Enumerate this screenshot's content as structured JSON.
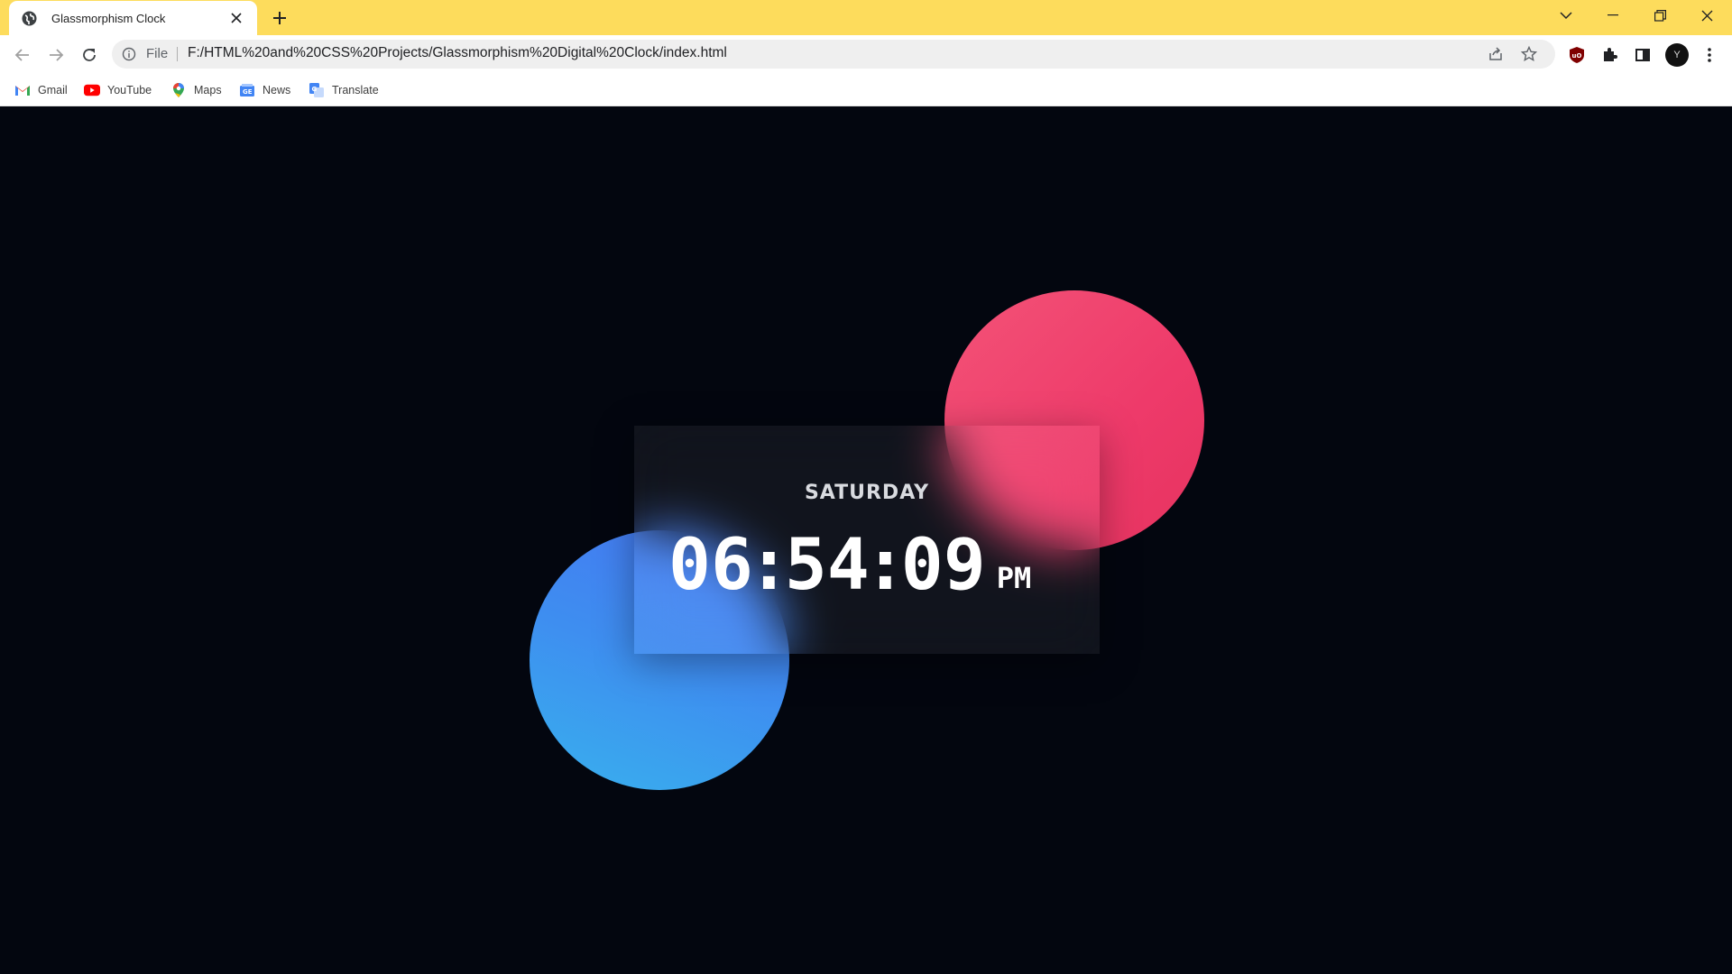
{
  "browser": {
    "tab": {
      "title": "Glassmorphism Clock",
      "favicon": "globe-icon"
    },
    "address": {
      "scheme_label": "File",
      "url": "F:/HTML%20and%20CSS%20Projects/Glassmorphism%20Digital%20Clock/index.html"
    },
    "bookmarks": [
      {
        "label": "Gmail",
        "icon": "gmail-icon"
      },
      {
        "label": "YouTube",
        "icon": "youtube-icon"
      },
      {
        "label": "Maps",
        "icon": "maps-icon"
      },
      {
        "label": "News",
        "icon": "news-icon"
      },
      {
        "label": "Translate",
        "icon": "translate-icon"
      }
    ],
    "profile_initial": "Y",
    "titlebar_color": "#fddc5c"
  },
  "clock": {
    "day": "SATURDAY",
    "hours": "06",
    "minutes": "54",
    "seconds": "09",
    "separator": ":",
    "ampm": "PM"
  },
  "colors": {
    "background": "#03060f",
    "red_circle": "#ee3a6a",
    "blue_circle": "#3e8ef0"
  }
}
